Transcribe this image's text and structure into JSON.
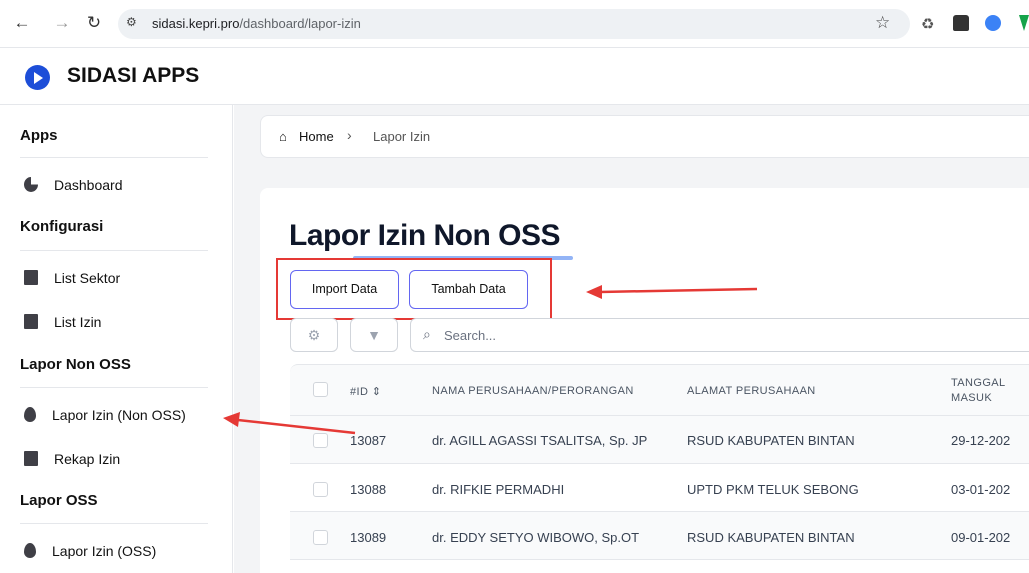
{
  "browser": {
    "url_host": "sidasi.kepri.pro",
    "url_path": "/dashboard/lapor-izin"
  },
  "app": {
    "name": "SIDASI APPS"
  },
  "sidebar": {
    "sections": [
      {
        "heading": "Apps",
        "items": [
          {
            "label": "Dashboard",
            "icon": "pie-chart-icon"
          }
        ]
      },
      {
        "heading": "Konfigurasi",
        "items": [
          {
            "label": "List Sektor",
            "icon": "book-icon"
          },
          {
            "label": "List Izin",
            "icon": "book-icon"
          }
        ]
      },
      {
        "heading": "Lapor Non OSS",
        "items": [
          {
            "label": "Lapor Izin (Non OSS)",
            "icon": "drop-icon"
          },
          {
            "label": "Rekap Izin",
            "icon": "book-icon"
          }
        ]
      },
      {
        "heading": "Lapor OSS",
        "items": [
          {
            "label": "Lapor Izin (OSS)",
            "icon": "drop-icon"
          }
        ]
      }
    ]
  },
  "breadcrumb": {
    "home": "Home",
    "current": "Lapor Izin"
  },
  "page": {
    "title": "Lapor Izin Non OSS",
    "import_label": "Import Data",
    "add_label": "Tambah Data",
    "search_placeholder": "Search..."
  },
  "table": {
    "headers": {
      "id": "#ID",
      "name": "NAMA PERUSAHAAN/PERORANGAN",
      "address": "ALAMAT PERUSAHAAN",
      "date_line1": "TANGGAL",
      "date_line2": "MASUK"
    },
    "rows": [
      {
        "id": "13087",
        "name": "dr. AGILL AGASSI TSALITSA, Sp. JP",
        "address": "RSUD KABUPATEN BINTAN",
        "date": "29-12-202"
      },
      {
        "id": "13088",
        "name": "dr. RIFKIE PERMADHI",
        "address": "UPTD PKM TELUK SEBONG",
        "date": "03-01-202"
      },
      {
        "id": "13089",
        "name": "dr. EDDY SETYO WIBOWO, Sp.OT",
        "address": "RSUD KABUPATEN BINTAN",
        "date": "09-01-202"
      }
    ]
  },
  "colors": {
    "annotation": "#e53935",
    "accent": "#6366f1",
    "brand": "#1d4ed8"
  }
}
